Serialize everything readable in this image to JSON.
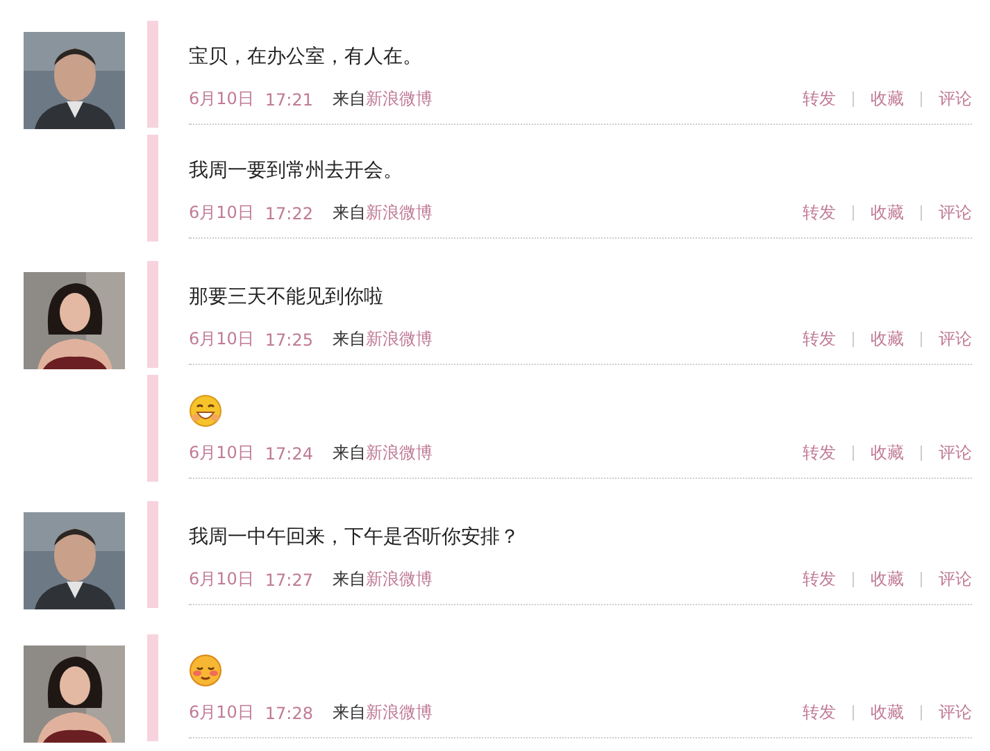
{
  "groups": [
    {
      "avatar": {
        "kind": "picture"
      },
      "messages": [
        {
          "kind": "text",
          "text": "宝贝，在办公室，有人在。",
          "date": "6月10日",
          "time": "17:21",
          "via": "来自",
          "source": "新浪微博",
          "actions": [
            "转发",
            "收藏",
            "评论"
          ]
        },
        {
          "kind": "text",
          "text": "我周一要到常州去开会。",
          "date": "6月10日",
          "time": "17:22",
          "via": "来自",
          "source": "新浪微博",
          "actions": [
            "转发",
            "收藏",
            "评论"
          ]
        }
      ]
    },
    {
      "avatar": {
        "kind": "picture"
      },
      "messages": [
        {
          "kind": "text",
          "text": "那要三天不能见到你啦",
          "date": "6月10日",
          "time": "17:25",
          "via": "来自",
          "source": "新浪微博",
          "actions": [
            "转发",
            "收藏",
            "评论"
          ]
        },
        {
          "kind": "grin",
          "date": "6月10日",
          "time": "17:24",
          "via": "来自",
          "source": "新浪微博",
          "actions": [
            "转发",
            "收藏",
            "评论"
          ]
        }
      ]
    },
    {
      "avatar": {
        "kind": "picture"
      },
      "messages": [
        {
          "kind": "text",
          "text": "我周一中午回来，下午是否听你安排？",
          "date": "6月10日",
          "time": "17:27",
          "via": "来自",
          "source": "新浪微博",
          "actions": [
            "转发",
            "收藏",
            "评论"
          ]
        }
      ]
    },
    {
      "avatar": {
        "kind": "picture"
      },
      "messages": [
        {
          "kind": "blush",
          "date": "6月10日",
          "time": "17:28",
          "via": "来自",
          "source": "新浪微博",
          "actions": [
            "转发",
            "收藏",
            "评论"
          ]
        }
      ]
    }
  ]
}
